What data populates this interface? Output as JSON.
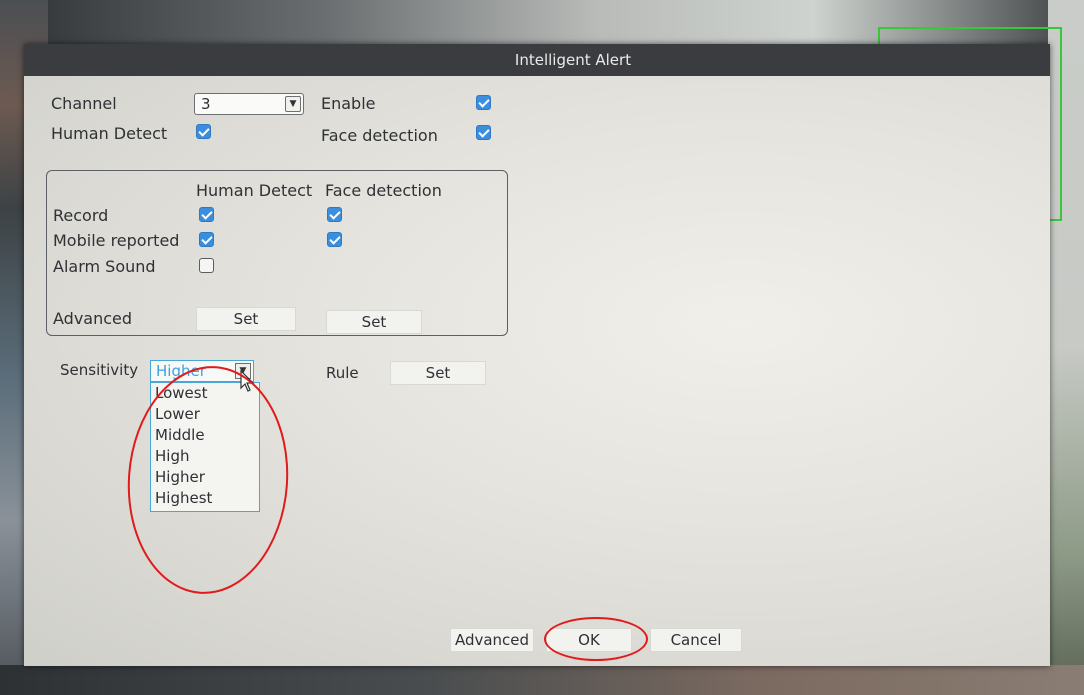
{
  "dialog": {
    "title": "Intelligent Alert",
    "channel_label": "Channel",
    "channel_value": "3",
    "enable_label": "Enable",
    "enable_checked": true,
    "human_detect_label": "Human Detect",
    "human_detect_checked": true,
    "face_detection_label": "Face detection",
    "face_detection_checked": true
  },
  "actions_group": {
    "col_human": "Human Detect",
    "col_face": "Face detection",
    "rows": [
      {
        "label": "Record",
        "human": true,
        "face": true
      },
      {
        "label": "Mobile reported",
        "human": true,
        "face": true
      },
      {
        "label": "Alarm Sound",
        "human": false,
        "face": null
      }
    ],
    "advanced_label": "Advanced",
    "set_human": "Set",
    "set_face": "Set"
  },
  "sensitivity": {
    "label": "Sensitivity",
    "selected": "Higher",
    "options": [
      "Lowest",
      "Lower",
      "Middle",
      "High",
      "Higher",
      "Highest"
    ]
  },
  "rule": {
    "label": "Rule",
    "set": "Set"
  },
  "footer": {
    "advanced": "Advanced",
    "ok": "OK",
    "cancel": "Cancel"
  },
  "colors": {
    "checkbox_on": "#3b8ede",
    "annotation_red": "#e01b1b",
    "select_accent": "#3ea3da"
  }
}
